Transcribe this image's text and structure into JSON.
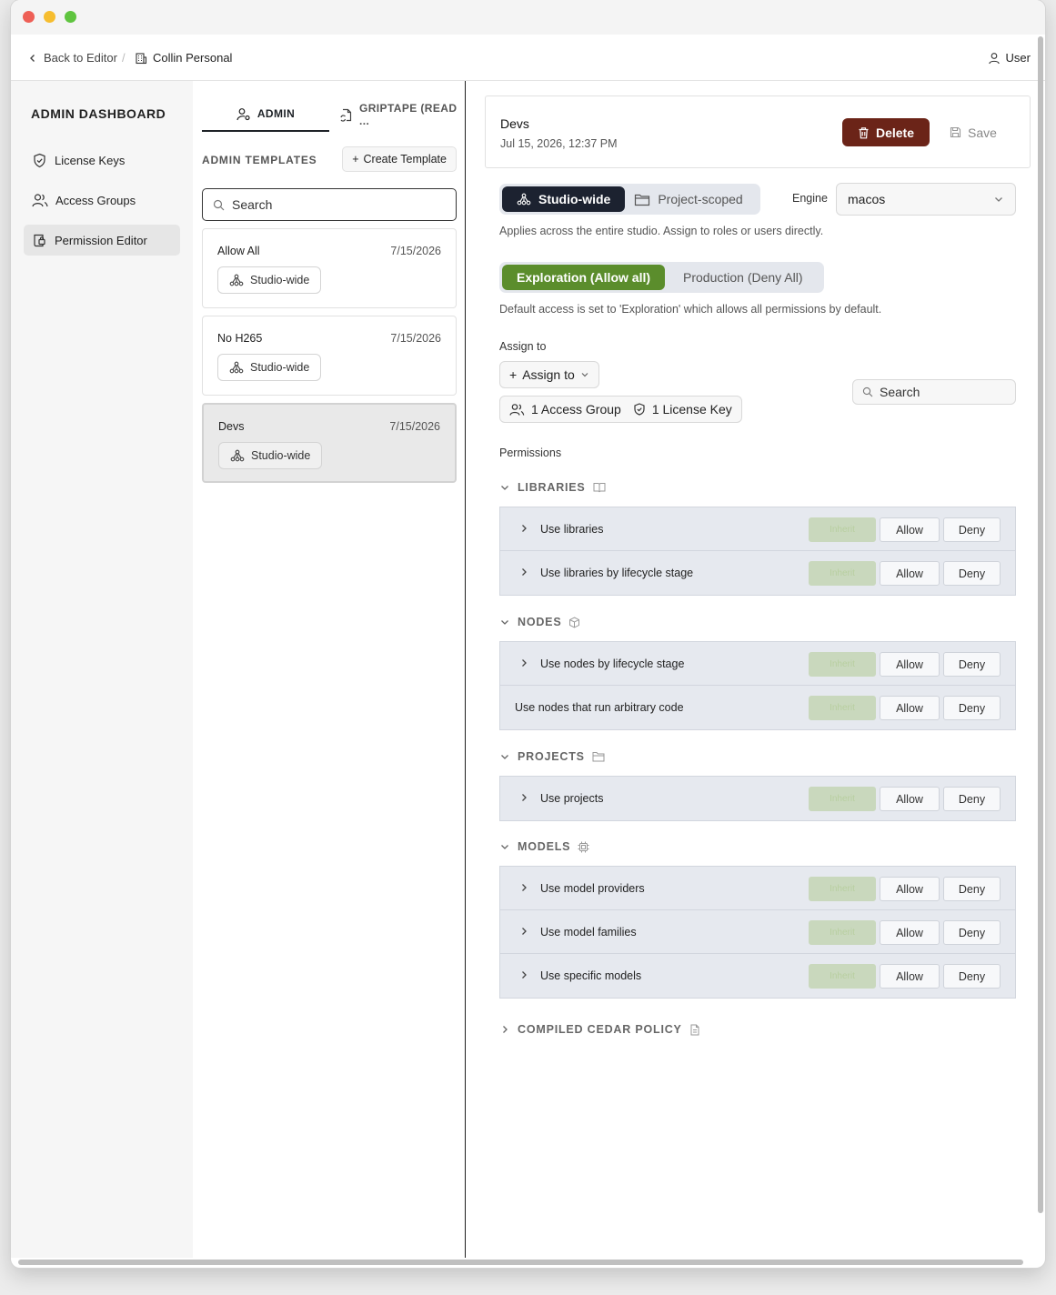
{
  "topnav": {
    "back_label": "Back to Editor",
    "separator": "/",
    "workspace": "Collin Personal",
    "user_label": "User"
  },
  "sidebar": {
    "title": "ADMIN DASHBOARD",
    "items": [
      {
        "label": "License Keys",
        "icon": "shield-check-icon"
      },
      {
        "label": "Access Groups",
        "icon": "users-icon"
      },
      {
        "label": "Permission Editor",
        "icon": "document-lock-icon",
        "active": true
      }
    ]
  },
  "templates_panel": {
    "tabs": [
      {
        "label": "ADMIN",
        "active": true
      },
      {
        "label": "GRIPTAPE (READ ..."
      }
    ],
    "section_label": "ADMIN TEMPLATES",
    "create_label": "Create Template",
    "search_placeholder": "Search",
    "items": [
      {
        "name": "Allow All",
        "date": "7/15/2026",
        "scope": "Studio-wide"
      },
      {
        "name": "No H265",
        "date": "7/15/2026",
        "scope": "Studio-wide"
      },
      {
        "name": "Devs",
        "date": "7/15/2026",
        "scope": "Studio-wide",
        "selected": true
      }
    ]
  },
  "editor": {
    "title": "Devs",
    "timestamp": "Jul 15, 2026, 12:37 PM",
    "delete_label": "Delete",
    "save_label": "Save",
    "scope_options": [
      "Studio-wide",
      "Project-scoped"
    ],
    "scope_selected": "Studio-wide",
    "engine_label": "Engine",
    "engine_value": "macos",
    "scope_help": "Applies across the entire studio. Assign to roles or users directly.",
    "mode_options": [
      "Exploration (Allow all)",
      "Production (Deny All)"
    ],
    "mode_selected": "Exploration (Allow all)",
    "mode_help": "Default access is set to 'Exploration' which allows all permissions by default.",
    "assign_label": "Assign to",
    "assign_button": "Assign to",
    "assign_summary": {
      "groups": "1 Access Group",
      "keys": "1 License Key"
    },
    "search_placeholder": "Search",
    "permissions_label": "Permissions",
    "inherit_label": "Inherit",
    "allow_label": "Allow",
    "deny_label": "Deny",
    "categories": [
      {
        "name": "LIBRARIES",
        "icon": "book-icon",
        "rows": [
          {
            "label": "Use libraries",
            "expandable": true
          },
          {
            "label": "Use libraries by lifecycle stage",
            "expandable": true
          }
        ]
      },
      {
        "name": "NODES",
        "icon": "cube-icon",
        "rows": [
          {
            "label": "Use nodes by lifecycle stage",
            "expandable": true
          },
          {
            "label": "Use nodes that run arbitrary code",
            "expandable": false
          }
        ]
      },
      {
        "name": "PROJECTS",
        "icon": "folder-icon",
        "rows": [
          {
            "label": "Use projects",
            "expandable": true
          }
        ]
      },
      {
        "name": "MODELS",
        "icon": "chip-icon",
        "rows": [
          {
            "label": "Use model providers",
            "expandable": true
          },
          {
            "label": "Use model families",
            "expandable": true
          },
          {
            "label": "Use specific models",
            "expandable": true
          }
        ]
      }
    ],
    "compiled_label": "COMPILED CEDAR POLICY"
  }
}
